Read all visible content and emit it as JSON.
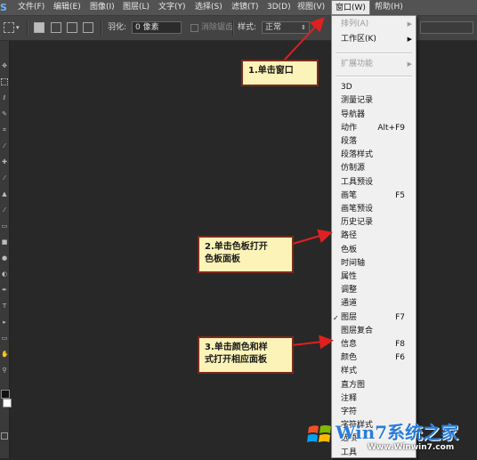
{
  "menubar": {
    "logo": "S",
    "items": [
      "文件(F)",
      "编辑(E)",
      "图像(I)",
      "图层(L)",
      "文字(Y)",
      "选择(S)",
      "滤镜(T)",
      "3D(D)",
      "视图(V)",
      "窗口(W)",
      "帮助(H)"
    ]
  },
  "options": {
    "feather_label": "羽化:",
    "feather_value": "0 像素",
    "antialias_label": "消除锯齿",
    "style_label": "样式:",
    "style_value": "正常"
  },
  "window_menu": {
    "items": [
      {
        "label": "排列(A)",
        "submenu": true,
        "disabled": true
      },
      {
        "label": "工作区(K)",
        "submenu": true
      },
      {
        "separator": true
      },
      {
        "label": "扩展功能",
        "submenu": true,
        "disabled": true
      },
      {
        "separator": true
      },
      {
        "label": "3D"
      },
      {
        "label": "测量记录"
      },
      {
        "label": "导航器"
      },
      {
        "label": "动作",
        "shortcut": "Alt+F9"
      },
      {
        "label": "段落"
      },
      {
        "label": "段落样式"
      },
      {
        "label": "仿制源"
      },
      {
        "label": "工具预设"
      },
      {
        "label": "画笔",
        "shortcut": "F5"
      },
      {
        "label": "画笔预设"
      },
      {
        "label": "历史记录"
      },
      {
        "label": "路径"
      },
      {
        "label": "色板"
      },
      {
        "label": "时间轴"
      },
      {
        "label": "属性"
      },
      {
        "label": "调整"
      },
      {
        "label": "通道"
      },
      {
        "label": "图层",
        "shortcut": "F7",
        "checked": true
      },
      {
        "label": "图层复合"
      },
      {
        "label": "信息",
        "shortcut": "F8"
      },
      {
        "label": "颜色",
        "shortcut": "F6"
      },
      {
        "label": "样式"
      },
      {
        "label": "直方图"
      },
      {
        "label": "注释"
      },
      {
        "label": "字符"
      },
      {
        "label": "字符样式"
      },
      {
        "label": "选项"
      },
      {
        "label": "工具"
      }
    ]
  },
  "callouts": {
    "c1": "1.单击窗口",
    "c2_line1": "2.单击色板打开",
    "c2_line2": "色板面板",
    "c3_line1": "3.单击颜色和样",
    "c3_line2": "式打开相应面板"
  },
  "watermark": {
    "brand": "Win7系统之家",
    "url": "Www.Winwin7.com"
  },
  "colors": {
    "callout_border": "#7b2a1c",
    "callout_fill": "#fbf3b7",
    "arrow": "#e02020"
  }
}
